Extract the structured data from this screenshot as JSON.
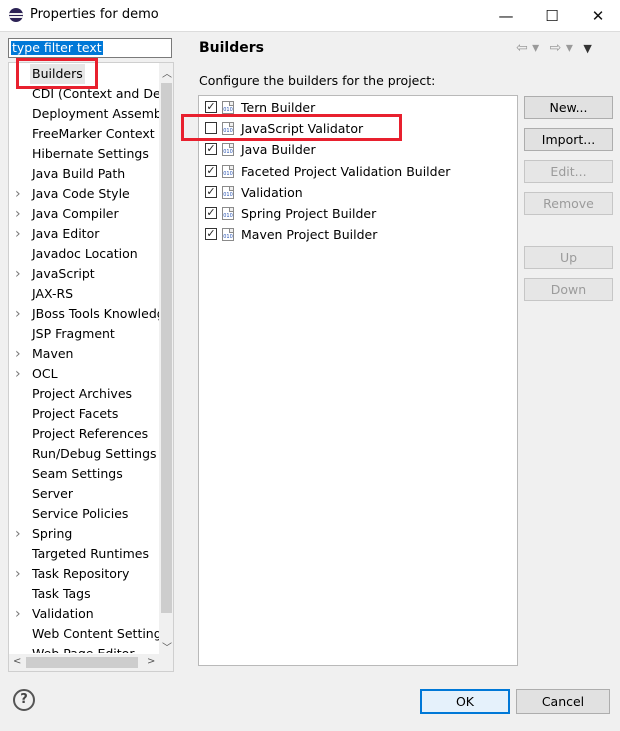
{
  "window": {
    "title": "Properties for demo",
    "minimize_glyph": "—",
    "maximize_glyph": "☐",
    "close_glyph": "✕"
  },
  "filter": {
    "value": "type filter text"
  },
  "tree": {
    "items": [
      {
        "label": "Builders",
        "expandable": false,
        "selected": true
      },
      {
        "label": "CDI (Context and Dep",
        "expandable": false
      },
      {
        "label": "Deployment Assembly",
        "expandable": false
      },
      {
        "label": "FreeMarker Context",
        "expandable": false
      },
      {
        "label": "Hibernate Settings",
        "expandable": false
      },
      {
        "label": "Java Build Path",
        "expandable": false
      },
      {
        "label": "Java Code Style",
        "expandable": true
      },
      {
        "label": "Java Compiler",
        "expandable": true
      },
      {
        "label": "Java Editor",
        "expandable": true
      },
      {
        "label": "Javadoc Location",
        "expandable": false
      },
      {
        "label": "JavaScript",
        "expandable": true
      },
      {
        "label": "JAX-RS",
        "expandable": false
      },
      {
        "label": "JBoss Tools Knowledg",
        "expandable": true
      },
      {
        "label": "JSP Fragment",
        "expandable": false
      },
      {
        "label": "Maven",
        "expandable": true
      },
      {
        "label": "OCL",
        "expandable": true
      },
      {
        "label": "Project Archives",
        "expandable": false
      },
      {
        "label": "Project Facets",
        "expandable": false
      },
      {
        "label": "Project References",
        "expandable": false
      },
      {
        "label": "Run/Debug Settings",
        "expandable": false
      },
      {
        "label": "Seam Settings",
        "expandable": false
      },
      {
        "label": "Server",
        "expandable": false
      },
      {
        "label": "Service Policies",
        "expandable": false
      },
      {
        "label": "Spring",
        "expandable": true
      },
      {
        "label": "Targeted Runtimes",
        "expandable": false
      },
      {
        "label": "Task Repository",
        "expandable": true
      },
      {
        "label": "Task Tags",
        "expandable": false
      },
      {
        "label": "Validation",
        "expandable": true
      },
      {
        "label": "Web Content Settings",
        "expandable": false
      },
      {
        "label": "Web Page Editor",
        "expandable": false
      }
    ]
  },
  "page": {
    "title": "Builders",
    "description": "Configure the builders for the project:",
    "nav": {
      "back": "⇦ ▾",
      "forward": "⇨ ▾",
      "menu": "▼"
    }
  },
  "builders": [
    {
      "label": "Tern Builder",
      "checked": true
    },
    {
      "label": "JavaScript Validator",
      "checked": false
    },
    {
      "label": "Java Builder",
      "checked": true
    },
    {
      "label": "Faceted Project Validation Builder",
      "checked": true
    },
    {
      "label": "Validation",
      "checked": true
    },
    {
      "label": "Spring Project Builder",
      "checked": true
    },
    {
      "label": "Maven Project Builder",
      "checked": true
    }
  ],
  "builder_icon_text": "010",
  "buttons": {
    "new": "New...",
    "import": "Import...",
    "edit": "Edit...",
    "remove": "Remove",
    "up": "Up",
    "down": "Down"
  },
  "footer": {
    "help": "?",
    "ok": "OK",
    "cancel": "Cancel"
  },
  "colors": {
    "accent": "#0078d7",
    "annotation_red": "#e8202e"
  }
}
